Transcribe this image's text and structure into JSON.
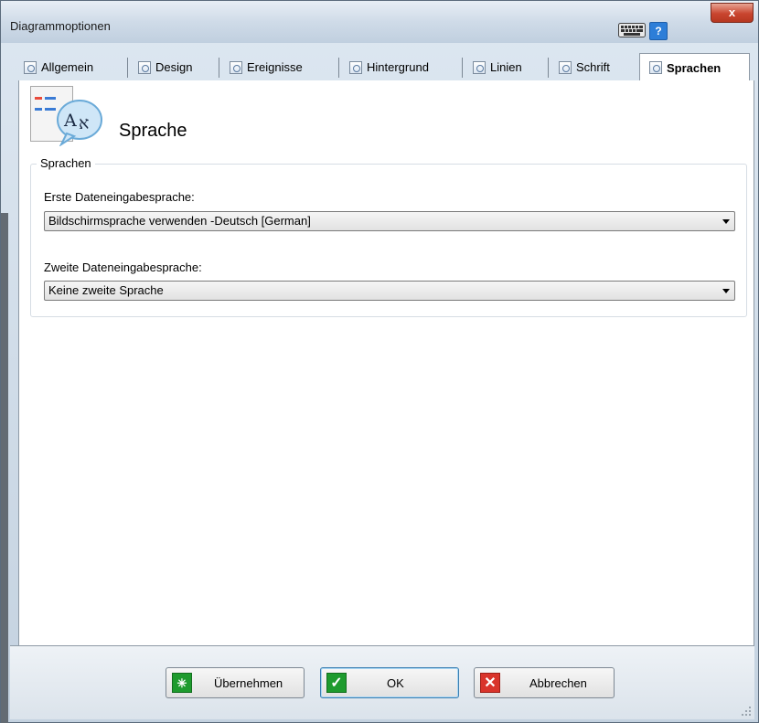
{
  "window": {
    "title": "Diagrammoptionen",
    "help_label": "?",
    "close_label": "x"
  },
  "tabs": [
    {
      "label": "Allgemein",
      "icon": "general-settings-icon"
    },
    {
      "label": "Design",
      "icon": "design-icon"
    },
    {
      "label": "Ereignisse",
      "icon": "events-icon"
    },
    {
      "label": "Hintergrund",
      "icon": "background-icon"
    },
    {
      "label": "Linien",
      "icon": "lines-icon"
    },
    {
      "label": "Schrift",
      "icon": "font-icon"
    },
    {
      "label": "Sprachen",
      "icon": "languages-icon",
      "active": true
    }
  ],
  "page": {
    "heading": "Sprache"
  },
  "group": {
    "legend": "Sprachen",
    "first_label": "Erste Dateneingabesprache:",
    "first_value": "Bildschirmsprache verwenden -Deutsch [German]",
    "second_label": "Zweite Dateneingabesprache:",
    "second_value": "Keine zweite Sprache"
  },
  "buttons": {
    "apply": "Übernehmen",
    "ok": "OK",
    "cancel": "Abbrechen"
  },
  "colors": {
    "apply_icon": "#1e9b2e",
    "ok_icon": "#1e9b2e",
    "cancel_icon": "#d9342b",
    "help": "#2d7ed8",
    "close": "#c9452f"
  }
}
